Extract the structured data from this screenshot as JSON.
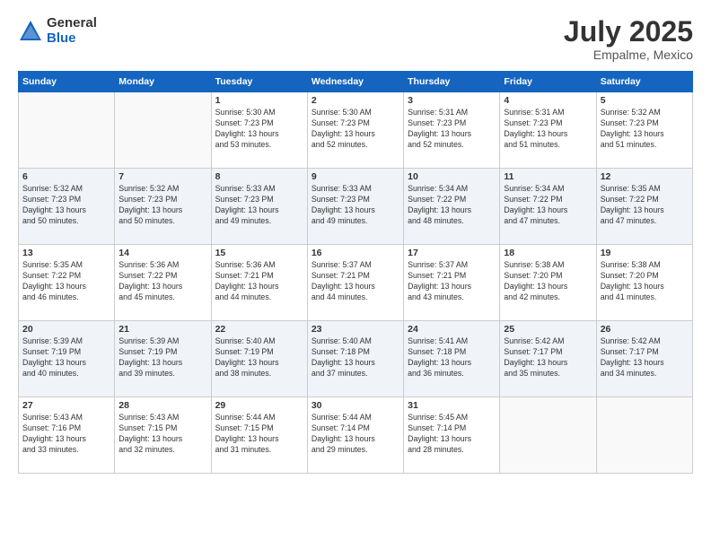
{
  "header": {
    "logo_general": "General",
    "logo_blue": "Blue",
    "month": "July 2025",
    "location": "Empalme, Mexico"
  },
  "weekdays": [
    "Sunday",
    "Monday",
    "Tuesday",
    "Wednesday",
    "Thursday",
    "Friday",
    "Saturday"
  ],
  "weeks": [
    [
      {
        "day": "",
        "info": ""
      },
      {
        "day": "",
        "info": ""
      },
      {
        "day": "1",
        "info": "Sunrise: 5:30 AM\nSunset: 7:23 PM\nDaylight: 13 hours\nand 53 minutes."
      },
      {
        "day": "2",
        "info": "Sunrise: 5:30 AM\nSunset: 7:23 PM\nDaylight: 13 hours\nand 52 minutes."
      },
      {
        "day": "3",
        "info": "Sunrise: 5:31 AM\nSunset: 7:23 PM\nDaylight: 13 hours\nand 52 minutes."
      },
      {
        "day": "4",
        "info": "Sunrise: 5:31 AM\nSunset: 7:23 PM\nDaylight: 13 hours\nand 51 minutes."
      },
      {
        "day": "5",
        "info": "Sunrise: 5:32 AM\nSunset: 7:23 PM\nDaylight: 13 hours\nand 51 minutes."
      }
    ],
    [
      {
        "day": "6",
        "info": "Sunrise: 5:32 AM\nSunset: 7:23 PM\nDaylight: 13 hours\nand 50 minutes."
      },
      {
        "day": "7",
        "info": "Sunrise: 5:32 AM\nSunset: 7:23 PM\nDaylight: 13 hours\nand 50 minutes."
      },
      {
        "day": "8",
        "info": "Sunrise: 5:33 AM\nSunset: 7:23 PM\nDaylight: 13 hours\nand 49 minutes."
      },
      {
        "day": "9",
        "info": "Sunrise: 5:33 AM\nSunset: 7:23 PM\nDaylight: 13 hours\nand 49 minutes."
      },
      {
        "day": "10",
        "info": "Sunrise: 5:34 AM\nSunset: 7:22 PM\nDaylight: 13 hours\nand 48 minutes."
      },
      {
        "day": "11",
        "info": "Sunrise: 5:34 AM\nSunset: 7:22 PM\nDaylight: 13 hours\nand 47 minutes."
      },
      {
        "day": "12",
        "info": "Sunrise: 5:35 AM\nSunset: 7:22 PM\nDaylight: 13 hours\nand 47 minutes."
      }
    ],
    [
      {
        "day": "13",
        "info": "Sunrise: 5:35 AM\nSunset: 7:22 PM\nDaylight: 13 hours\nand 46 minutes."
      },
      {
        "day": "14",
        "info": "Sunrise: 5:36 AM\nSunset: 7:22 PM\nDaylight: 13 hours\nand 45 minutes."
      },
      {
        "day": "15",
        "info": "Sunrise: 5:36 AM\nSunset: 7:21 PM\nDaylight: 13 hours\nand 44 minutes."
      },
      {
        "day": "16",
        "info": "Sunrise: 5:37 AM\nSunset: 7:21 PM\nDaylight: 13 hours\nand 44 minutes."
      },
      {
        "day": "17",
        "info": "Sunrise: 5:37 AM\nSunset: 7:21 PM\nDaylight: 13 hours\nand 43 minutes."
      },
      {
        "day": "18",
        "info": "Sunrise: 5:38 AM\nSunset: 7:20 PM\nDaylight: 13 hours\nand 42 minutes."
      },
      {
        "day": "19",
        "info": "Sunrise: 5:38 AM\nSunset: 7:20 PM\nDaylight: 13 hours\nand 41 minutes."
      }
    ],
    [
      {
        "day": "20",
        "info": "Sunrise: 5:39 AM\nSunset: 7:19 PM\nDaylight: 13 hours\nand 40 minutes."
      },
      {
        "day": "21",
        "info": "Sunrise: 5:39 AM\nSunset: 7:19 PM\nDaylight: 13 hours\nand 39 minutes."
      },
      {
        "day": "22",
        "info": "Sunrise: 5:40 AM\nSunset: 7:19 PM\nDaylight: 13 hours\nand 38 minutes."
      },
      {
        "day": "23",
        "info": "Sunrise: 5:40 AM\nSunset: 7:18 PM\nDaylight: 13 hours\nand 37 minutes."
      },
      {
        "day": "24",
        "info": "Sunrise: 5:41 AM\nSunset: 7:18 PM\nDaylight: 13 hours\nand 36 minutes."
      },
      {
        "day": "25",
        "info": "Sunrise: 5:42 AM\nSunset: 7:17 PM\nDaylight: 13 hours\nand 35 minutes."
      },
      {
        "day": "26",
        "info": "Sunrise: 5:42 AM\nSunset: 7:17 PM\nDaylight: 13 hours\nand 34 minutes."
      }
    ],
    [
      {
        "day": "27",
        "info": "Sunrise: 5:43 AM\nSunset: 7:16 PM\nDaylight: 13 hours\nand 33 minutes."
      },
      {
        "day": "28",
        "info": "Sunrise: 5:43 AM\nSunset: 7:15 PM\nDaylight: 13 hours\nand 32 minutes."
      },
      {
        "day": "29",
        "info": "Sunrise: 5:44 AM\nSunset: 7:15 PM\nDaylight: 13 hours\nand 31 minutes."
      },
      {
        "day": "30",
        "info": "Sunrise: 5:44 AM\nSunset: 7:14 PM\nDaylight: 13 hours\nand 29 minutes."
      },
      {
        "day": "31",
        "info": "Sunrise: 5:45 AM\nSunset: 7:14 PM\nDaylight: 13 hours\nand 28 minutes."
      },
      {
        "day": "",
        "info": ""
      },
      {
        "day": "",
        "info": ""
      }
    ]
  ]
}
